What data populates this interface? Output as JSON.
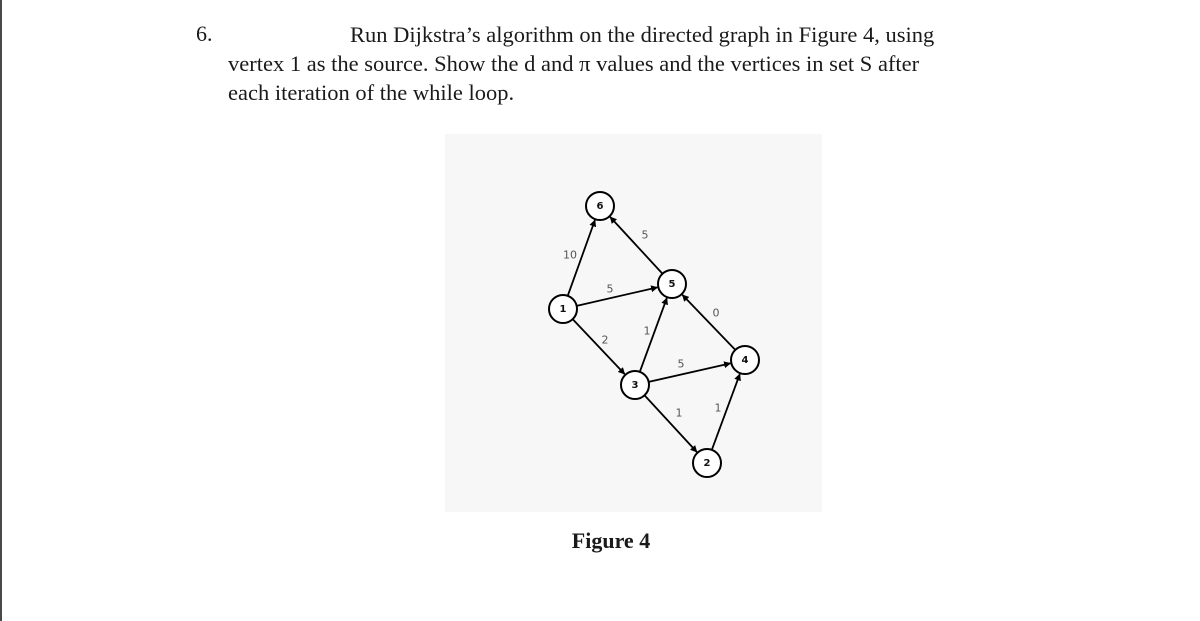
{
  "problem": {
    "number": "6.",
    "line1": "Run Dijkstra’s algorithm on the directed graph in Figure 4, using",
    "line2": "vertex 1 as the source. Show the d and π values and the vertices in set S after",
    "line3": "each iteration of the while loop."
  },
  "figure": {
    "caption": "Figure 4",
    "graph": {
      "directed": true,
      "nodes": [
        {
          "id": "1",
          "label": "1"
        },
        {
          "id": "2",
          "label": "2"
        },
        {
          "id": "3",
          "label": "3"
        },
        {
          "id": "4",
          "label": "4"
        },
        {
          "id": "5",
          "label": "5"
        },
        {
          "id": "6",
          "label": "6"
        }
      ],
      "edges": [
        {
          "from": "1",
          "to": "6",
          "weight": "10"
        },
        {
          "from": "1",
          "to": "5",
          "weight": "5"
        },
        {
          "from": "1",
          "to": "3",
          "weight": "2"
        },
        {
          "from": "5",
          "to": "6",
          "weight": "5"
        },
        {
          "from": "3",
          "to": "5",
          "weight": "1"
        },
        {
          "from": "3",
          "to": "4",
          "weight": "5"
        },
        {
          "from": "3",
          "to": "2",
          "weight": "1"
        },
        {
          "from": "4",
          "to": "5",
          "weight": "0"
        },
        {
          "from": "2",
          "to": "4",
          "weight": "1"
        }
      ]
    }
  }
}
